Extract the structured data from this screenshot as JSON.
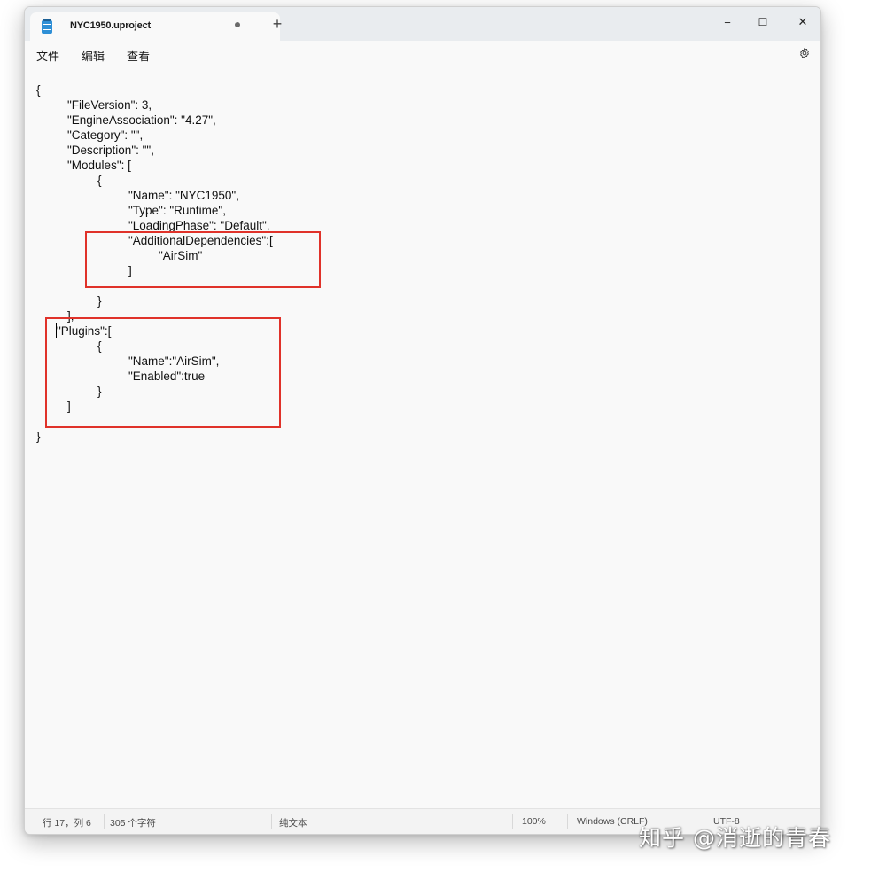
{
  "tab": {
    "title": "NYC1950.uproject",
    "new_tab_label": "+"
  },
  "window_controls": {
    "minimize": "−",
    "maximize": "☐",
    "close": "✕"
  },
  "menu": {
    "file": "文件",
    "edit": "编辑",
    "view": "查看"
  },
  "editor": {
    "lines": [
      "{",
      "\"FileVersion\": 3,",
      "\"EngineAssociation\": \"4.27\",",
      "\"Category\": \"\",",
      "\"Description\": \"\",",
      "\"Modules\": [",
      "{",
      "\"Name\": \"NYC1950\",",
      "\"Type\": \"Runtime\",",
      "\"LoadingPhase\": \"Default\",",
      "\"AdditionalDependencies\":[",
      "\"AirSim\"",
      "]",
      "}",
      "],",
      "\"Plugins\":[",
      "{",
      "\"Name\":\"AirSim\",",
      "\"Enabled\":true",
      "}",
      "]",
      "}"
    ]
  },
  "status": {
    "position": "行 17，列 6",
    "char_count": "305 个字符",
    "format": "纯文本",
    "zoom": "100%",
    "line_ending": "Windows (CRLF)",
    "encoding": "UTF-8"
  },
  "watermark": "知乎 @消逝的青春",
  "colors": {
    "highlight_box": "#e0322a"
  }
}
